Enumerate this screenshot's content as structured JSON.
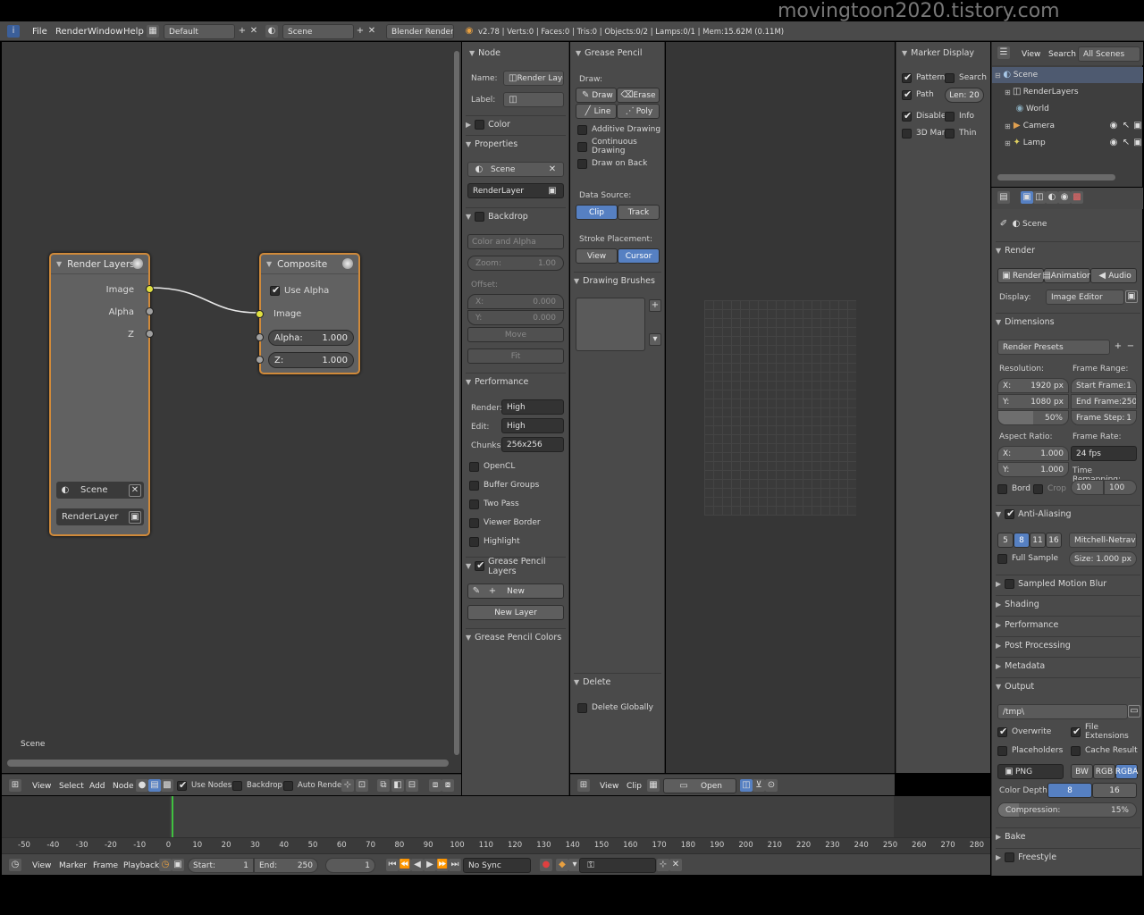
{
  "watermark": "movingtoon2020.tistory.com",
  "topbar": {
    "menus": [
      "File",
      "Render",
      "Window",
      "Help"
    ],
    "layout": "Default",
    "scene": "Scene",
    "engine": "Blender Render",
    "stats": "v2.78 | Verts:0 | Faces:0 | Tris:0 | Objects:0/2 | Lamps:0/1 | Mem:15.62M (0.11M)"
  },
  "node_editor": {
    "label": "Scene",
    "render_layers": {
      "title": "Render Layers",
      "outputs": [
        "Image",
        "Alpha",
        "Z"
      ],
      "scene": "Scene",
      "layer": "RenderLayer"
    },
    "composite": {
      "title": "Composite",
      "use_alpha": "Use Alpha",
      "image": "Image",
      "alpha_label": "Alpha:",
      "alpha_value": "1.000",
      "z_label": "Z:",
      "z_value": "1.000"
    },
    "header": {
      "menus": [
        "View",
        "Select",
        "Add",
        "Node"
      ],
      "use_nodes": "Use Nodes",
      "backdrop": "Backdrop",
      "auto_render": "Auto Render"
    }
  },
  "node_panel": {
    "node_title": "Node",
    "name_label": "Name:",
    "name_value": "Render Layers",
    "label_label": "Label:",
    "color": "Color",
    "properties": "Properties",
    "scene": "Scene",
    "renderlayer": "RenderLayer",
    "backdrop": "Backdrop",
    "backdrop_mode": "Color and Alpha",
    "zoom_label": "Zoom:",
    "zoom_value": "1.00",
    "offset_label": "Offset:",
    "x_label": "X:",
    "x_value": "0.000",
    "y_label": "Y:",
    "y_value": "0.000",
    "move": "Move",
    "fit": "Fit",
    "performance": "Performance",
    "render_label": "Render:",
    "render_value": "High",
    "edit_label": "Edit:",
    "edit_value": "High",
    "chunks_label": "Chunks:",
    "chunks_value": "256x256",
    "checks": [
      "OpenCL",
      "Buffer Groups",
      "Two Pass",
      "Viewer Border",
      "Highlight"
    ],
    "gp_layers": "Grease Pencil Layers",
    "new": "New",
    "new_layer": "New Layer",
    "gp_colors": "Grease Pencil Colors"
  },
  "gp_panel": {
    "title": "Grease Pencil",
    "draw_label": "Draw:",
    "draw": "Draw",
    "erase": "Erase",
    "line": "Line",
    "poly": "Poly",
    "checks": [
      "Additive Drawing",
      "Continuous Drawing",
      "Draw on Back"
    ],
    "data_source": "Data Source:",
    "clip": "Clip",
    "track": "Track",
    "stroke_placement": "Stroke Placement:",
    "view": "View",
    "cursor": "Cursor",
    "drawing_brushes": "Drawing Brushes",
    "delete": "Delete",
    "delete_globally": "Delete Globally"
  },
  "clip_header": {
    "menus": [
      "View",
      "Clip"
    ],
    "open": "Open"
  },
  "marker_display": {
    "title": "Marker Display",
    "pattern": "Pattern",
    "search": "Search",
    "path": "Path",
    "len": "Len: 20",
    "disabled": "Disabled",
    "info": "Info",
    "mark3d": "3D Mark",
    "thin": "Thin"
  },
  "outliner": {
    "view": "View",
    "search": "Search",
    "filter": "All Scenes",
    "items": [
      "Scene",
      "RenderLayers",
      "World",
      "Camera",
      "Lamp"
    ]
  },
  "properties": {
    "context": "Scene",
    "render": "Render",
    "render_btn": "Render",
    "animation_btn": "Animation",
    "audio_btn": "Audio",
    "display_label": "Display:",
    "display_value": "Image Editor",
    "dimensions": "Dimensions",
    "render_presets": "Render Presets",
    "resolution": "Resolution:",
    "res_x": "1920 px",
    "res_y": "1080 px",
    "res_pct": "50%",
    "x_label": "X:",
    "y_label": "Y:",
    "frame_range": "Frame Range:",
    "start_frame": "Start Frame:",
    "start_value": "1",
    "end_frame": "End Frame:",
    "end_value": "250",
    "frame_step": "Frame Step:",
    "step_value": "1",
    "aspect_ratio": "Aspect Ratio:",
    "aspect_x": "1.000",
    "aspect_y": "1.000",
    "frame_rate": "Frame Rate:",
    "fps": "24 fps",
    "time_remapping": "Time Remapping:",
    "remap_old": "100",
    "remap_new": "100",
    "bord": "Bord",
    "crop": "Crop",
    "anti_aliasing": "Anti-Aliasing",
    "aa_samples": [
      "5",
      "8",
      "11",
      "16"
    ],
    "filter": "Mitchell-Netravali",
    "full_sample": "Full Sample",
    "size_label": "Size:",
    "size_value": "1.000 px",
    "collapsed": [
      "Sampled Motion Blur",
      "Shading",
      "Performance",
      "Post Processing",
      "Metadata"
    ],
    "output": "Output",
    "path": "/tmp\\",
    "overwrite": "Overwrite",
    "file_extensions": "File Extensions",
    "placeholders": "Placeholders",
    "cache_result": "Cache Result",
    "format": "PNG",
    "bw": "BW",
    "rgb": "RGB",
    "rgba": "RGBA",
    "color_depth": "Color Depth:",
    "depth_8": "8",
    "depth_16": "16",
    "compression": "Compression:",
    "compression_value": "15%",
    "bake": "Bake",
    "freestyle": "Freestyle"
  },
  "timeline": {
    "ticks": [
      "-50",
      "-40",
      "-30",
      "-20",
      "-10",
      "0",
      "10",
      "20",
      "30",
      "40",
      "50",
      "60",
      "70",
      "80",
      "90",
      "100",
      "110",
      "120",
      "130",
      "140",
      "150",
      "160",
      "170",
      "180",
      "190",
      "200",
      "210",
      "220",
      "230",
      "240",
      "250",
      "260",
      "270",
      "280"
    ],
    "menus": [
      "View",
      "Marker",
      "Frame",
      "Playback"
    ],
    "start_label": "Start:",
    "start_value": "1",
    "end_label": "End:",
    "end_value": "250",
    "current": "1",
    "sync": "No Sync"
  }
}
